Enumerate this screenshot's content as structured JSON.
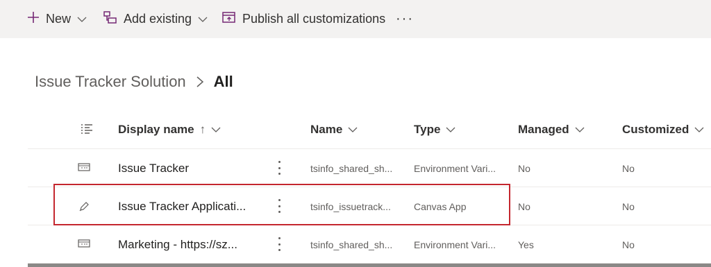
{
  "commandbar": {
    "new_label": "New",
    "add_existing_label": "Add existing",
    "publish_label": "Publish all customizations",
    "more_label": "···",
    "accent_color": "#742774"
  },
  "breadcrumb": {
    "parent": "Issue Tracker Solution",
    "current": "All"
  },
  "table": {
    "columns": {
      "display_name": "Display name",
      "sort_indicator": "↑",
      "name": "Name",
      "type": "Type",
      "managed": "Managed",
      "customized": "Customized"
    },
    "rows": [
      {
        "icon": "environment-variable-icon",
        "display_name": "Issue Tracker",
        "name": "tsinfo_shared_sh...",
        "type": "Environment Vari...",
        "managed": "No",
        "customized": "No"
      },
      {
        "icon": "pencil-icon",
        "display_name": "Issue Tracker Applicati...",
        "name": "tsinfo_issuetrack...",
        "type": "Canvas App",
        "managed": "No",
        "customized": "No"
      },
      {
        "icon": "environment-variable-icon",
        "display_name": "Marketing - https://sz...",
        "name": "tsinfo_shared_sh...",
        "type": "Environment Vari...",
        "managed": "Yes",
        "customized": "No"
      }
    ]
  },
  "highlight_color": "#c4262e"
}
